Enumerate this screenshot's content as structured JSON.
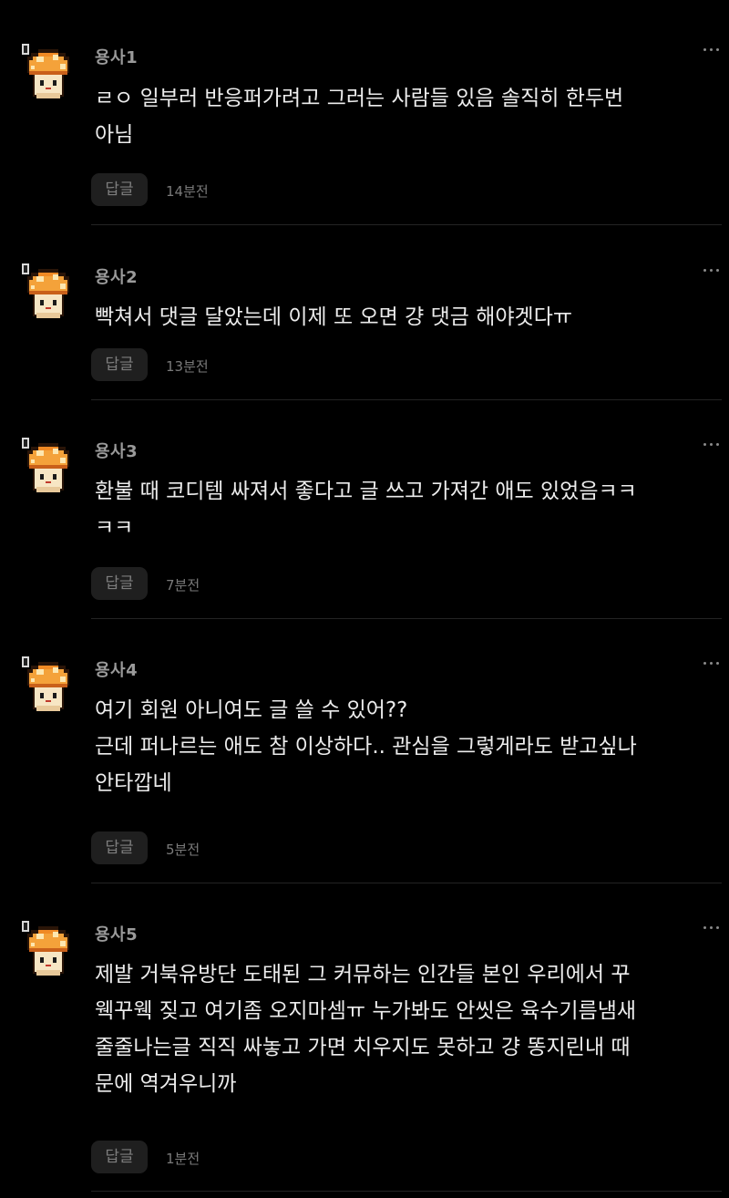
{
  "comments": [
    {
      "nickname": "용사1",
      "text": "ㄹㅇ 일부러 반응퍼가려고 그러는 사람들 있음 솔직히 한두번\n아님",
      "reply_label": "답글",
      "time": "14분전",
      "avatar_icon": "orange-mushroom-icon",
      "menu_icon": "more-options-icon"
    },
    {
      "nickname": "용사2",
      "text": "빡쳐서 댓글 달았는데 이제 또 오면 걍 댓금 해야겟다ㅠ",
      "reply_label": "답글",
      "time": "13분전",
      "avatar_icon": "orange-mushroom-icon",
      "menu_icon": "more-options-icon"
    },
    {
      "nickname": "용사3",
      "text": "환불 때 코디템 싸져서 좋다고 글 쓰고 가져간 애도 있었음ㅋㅋ\nㅋㅋ",
      "reply_label": "답글",
      "time": "7분전",
      "avatar_icon": "orange-mushroom-icon",
      "menu_icon": "more-options-icon"
    },
    {
      "nickname": "용사4",
      "text": "여기 회원 아니여도 글 쓸 수 있어??\n근데 퍼나르는 애도 참 이상하다.. 관심을 그렇게라도 받고싶나\n안타깝네",
      "reply_label": "답글",
      "time": "5분전",
      "avatar_icon": "orange-mushroom-icon",
      "menu_icon": "more-options-icon"
    },
    {
      "nickname": "용사5",
      "text": "제발 거북유방단 도태된 그 커뮤하는 인간들 본인 우리에서 꾸\n웩꾸웩 짖고 여기좀 오지마셈ㅠ 누가봐도 안씻은 육수기름냄새\n줄줄나는글 직직 싸놓고 가면 치우지도 못하고 걍 똥지린내 때\n문에 역겨우니까",
      "reply_label": "답글",
      "time": "1분전",
      "avatar_icon": "orange-mushroom-icon",
      "menu_icon": "more-options-icon"
    }
  ],
  "colors": {
    "background": "#000000",
    "nickname": "#9a9a9a",
    "text": "#ececec",
    "reply_button_bg": "#1f1f1f",
    "mushroom_cap": "#f4a23a",
    "mushroom_spots": "#fde7b0"
  }
}
